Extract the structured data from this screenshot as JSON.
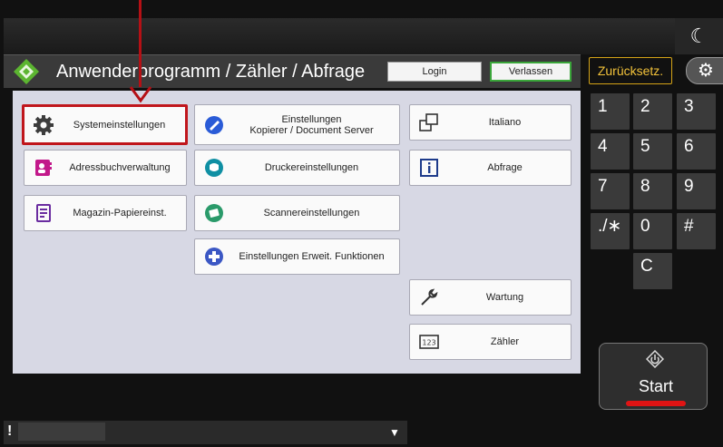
{
  "header": {
    "title": "Anwenderprogramm / Zähler / Abfrage",
    "login_label": "Login",
    "exit_label": "Verlassen"
  },
  "menu": {
    "system_settings": "Systemeinstellungen",
    "address_book": "Adressbuchverwaltung",
    "tray_paper": "Magazin-Papiereinst.",
    "copier_settings_line1": "Einstellungen",
    "copier_settings_line2": "Kopierer / Document Server",
    "printer_settings": "Druckereinstellungen",
    "scanner_settings": "Scannereinstellungen",
    "extended_settings": "Einstellungen Erweit. Funktionen",
    "language": "Italiano",
    "inquiry": "Abfrage",
    "maintenance": "Wartung",
    "counter": "Zähler"
  },
  "right_panel": {
    "reset_label": "Zurücksetz.",
    "keypad": [
      "1",
      "2",
      "3",
      "4",
      "5",
      "6",
      "7",
      "8",
      "9",
      "./∗",
      "0",
      "#",
      "C"
    ],
    "start_label": "Start"
  },
  "status": {
    "indicator": "!"
  },
  "icons": {
    "logo": "app-logo-icon",
    "settings": "gear-icon",
    "moon": "moon-icon"
  },
  "colors": {
    "highlight": "#c0161c",
    "exit_border": "#3aa53a",
    "reset_text": "#f2c23a",
    "start_underline": "#e01414",
    "panel_bg": "#d7d8e4"
  }
}
